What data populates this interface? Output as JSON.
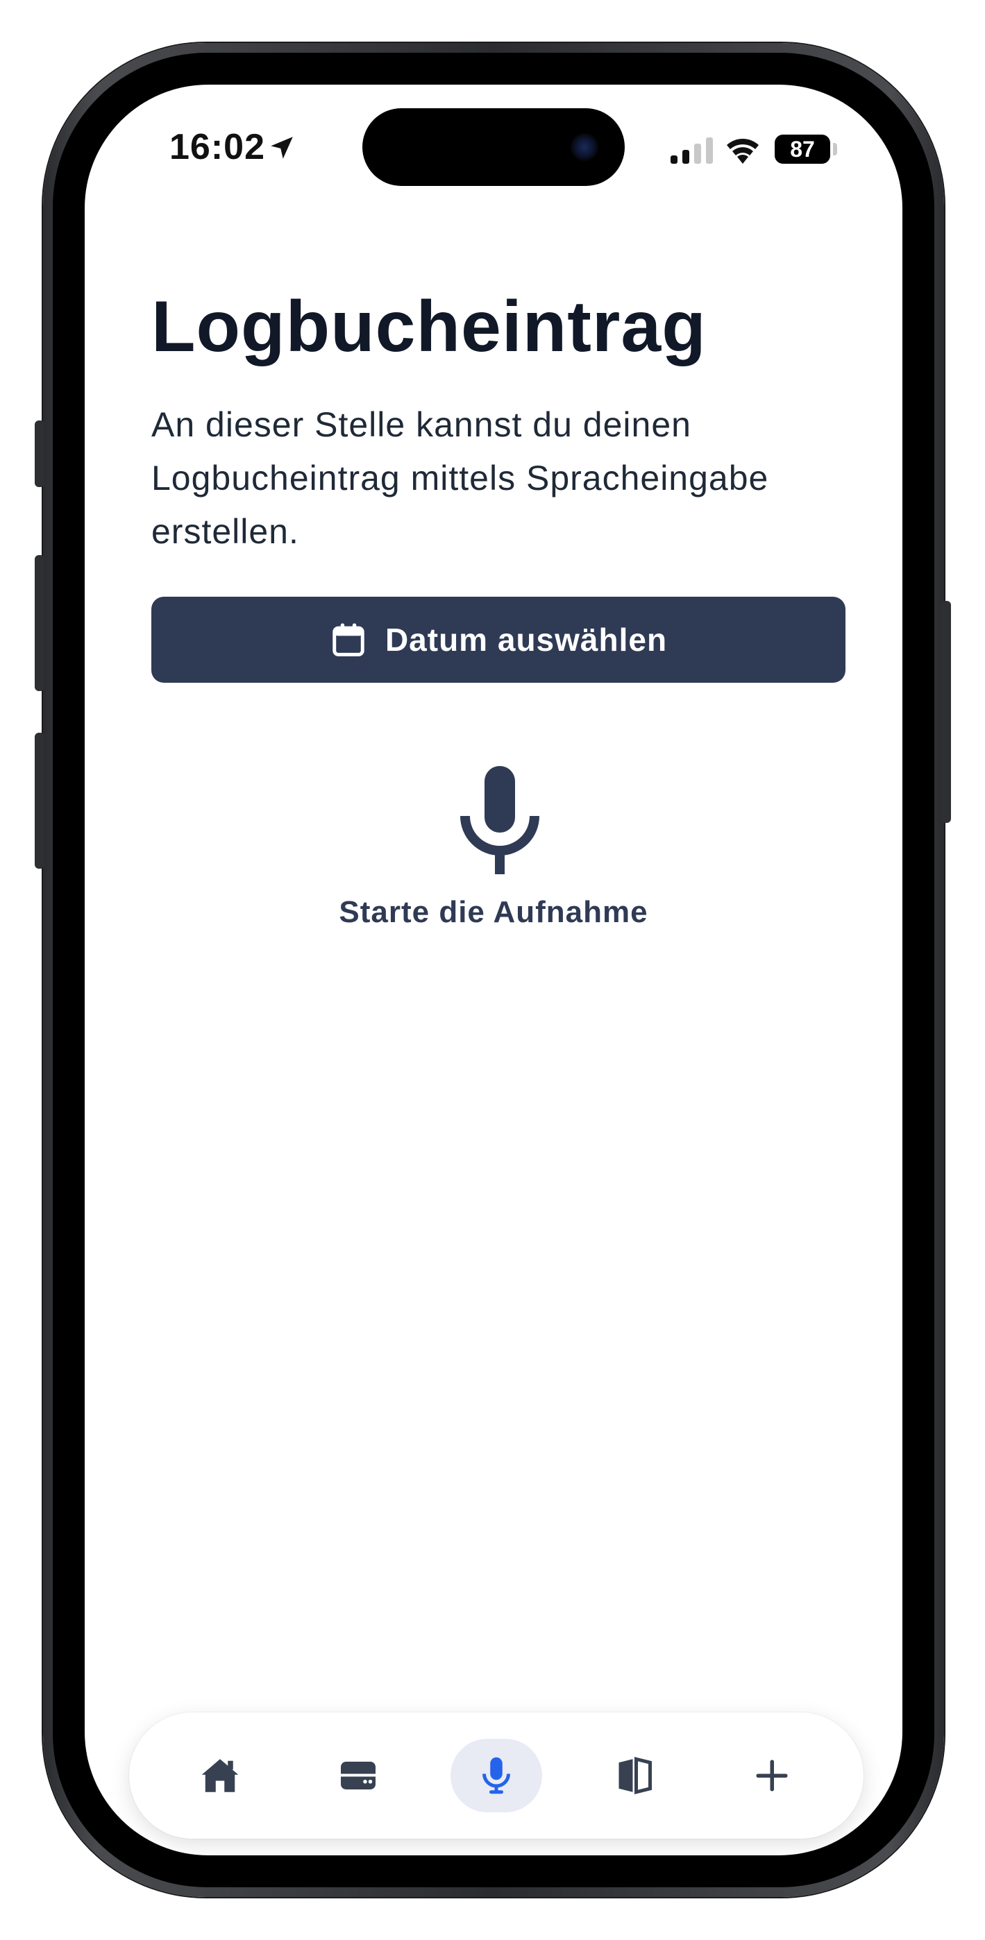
{
  "status_bar": {
    "time": "16:02",
    "battery": "87",
    "location_icon": "location-arrow-icon",
    "signal_icon": "cellular-signal-icon",
    "wifi_icon": "wifi-icon"
  },
  "page": {
    "title": "Logbucheintrag",
    "description": "An dieser Stelle kannst du deinen Logbucheintrag mittels Spracheingabe erstellen.",
    "date_button_label": "Datum auswählen",
    "date_button_icon": "calendar-icon",
    "record_icon": "microphone-icon",
    "record_caption": "Starte die Aufnahme"
  },
  "tab_bar": {
    "items": [
      {
        "icon": "home-icon",
        "active": false
      },
      {
        "icon": "card-icon",
        "active": false
      },
      {
        "icon": "microphone-icon",
        "active": true
      },
      {
        "icon": "book-open-icon",
        "active": false
      },
      {
        "icon": "plus-icon",
        "active": false
      }
    ]
  },
  "colors": {
    "primary": "#2f3a55",
    "active_tab_icon": "#2563eb",
    "active_tab_bg": "#e8ebf4",
    "title_text": "#111827"
  }
}
